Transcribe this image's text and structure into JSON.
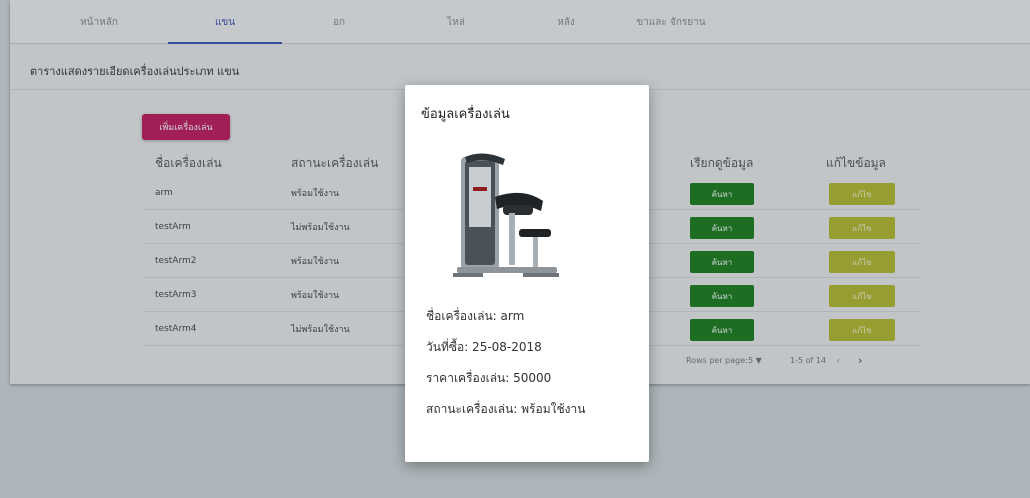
{
  "tabs": [
    {
      "label": "หน้าหลัก",
      "active": false
    },
    {
      "label": "แขน",
      "active": true
    },
    {
      "label": "อก",
      "active": false
    },
    {
      "label": "ไหล่",
      "active": false
    },
    {
      "label": "หลัง",
      "active": false
    },
    {
      "label": "ขาและ จักรยาน",
      "active": false
    }
  ],
  "page_title": "ตารางแสดงรายเอียดเครื่องเล่นประเภท แขน",
  "add_button": "เพิ่มเครื่องเล่น",
  "table": {
    "headers": [
      "ชื่อเครื่องเล่น",
      "สถานะเครื่องเล่น",
      "เรียกดูข้อมูล",
      "แก้ไขข้อมูล"
    ],
    "rows": [
      {
        "name": "arm",
        "status": "พร้อมใช้งาน",
        "view": "ค้นหา",
        "edit": "แก้ไข"
      },
      {
        "name": "testArm",
        "status": "ไม่พร้อมใช้งาน",
        "view": "ค้นหา",
        "edit": "แก้ไข"
      },
      {
        "name": "testArm2",
        "status": "พร้อมใช้งาน",
        "view": "ค้นหา",
        "edit": "แก้ไข"
      },
      {
        "name": "testArm3",
        "status": "พร้อมใช้งาน",
        "view": "ค้นหา",
        "edit": "แก้ไข"
      },
      {
        "name": "testArm4",
        "status": "ไม่พร้อมใช้งาน",
        "view": "ค้นหา",
        "edit": "แก้ไข"
      }
    ]
  },
  "pagination": {
    "rows_per_page_label": "Rows per page:",
    "rows_per_page_value": "5",
    "range": "1-5 of 14",
    "prev_icon": "chevron-left-icon",
    "next_icon": "chevron-right-icon"
  },
  "modal": {
    "title": "ข้อมูลเครื่องเล่น",
    "image_icon": "arm-curl-machine-image",
    "name_line": "ชื่อเครื่องเล่น: arm",
    "date_line": "วันที่ซื้อ: 25-08-2018",
    "price_line": "ราคาเครื่องเล่น: 50000",
    "status_line": "สถานะเครื่องเล่น: พร้อมใช้งาน"
  },
  "colors": {
    "tab_active": "#3f51b5",
    "add_button": "#c2185b",
    "view_button": "#1a7c1a",
    "edit_button": "#b6b92b"
  }
}
